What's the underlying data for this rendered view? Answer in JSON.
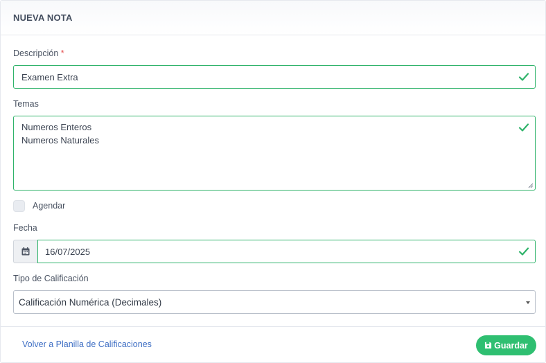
{
  "card": {
    "title": "NUEVA NOTA"
  },
  "form": {
    "descripcion": {
      "label": "Descripción",
      "required_mark": "*",
      "value": "Examen Extra"
    },
    "temas": {
      "label": "Temas",
      "lines": [
        "Numeros Enteros",
        "Numeros Naturales"
      ]
    },
    "agendar": {
      "label": "Agendar",
      "checked": false
    },
    "fecha": {
      "label": "Fecha",
      "value": "16/07/2025"
    },
    "tipo": {
      "label": "Tipo de Calificación",
      "selected": "Calificación Numérica (Decimales)"
    }
  },
  "footer": {
    "back_label": "Volver a Planilla de Calificaciones",
    "save_label": "Guardar"
  },
  "icons": {
    "valid": "check-icon",
    "calendar": "calendar-icon",
    "save": "floppy-disk-icon",
    "dropdown": "caret-down-icon"
  },
  "colors": {
    "valid": "#2fb36a",
    "save_button": "#2fbf71",
    "link": "#3f6fc4",
    "required": "#e55353"
  }
}
